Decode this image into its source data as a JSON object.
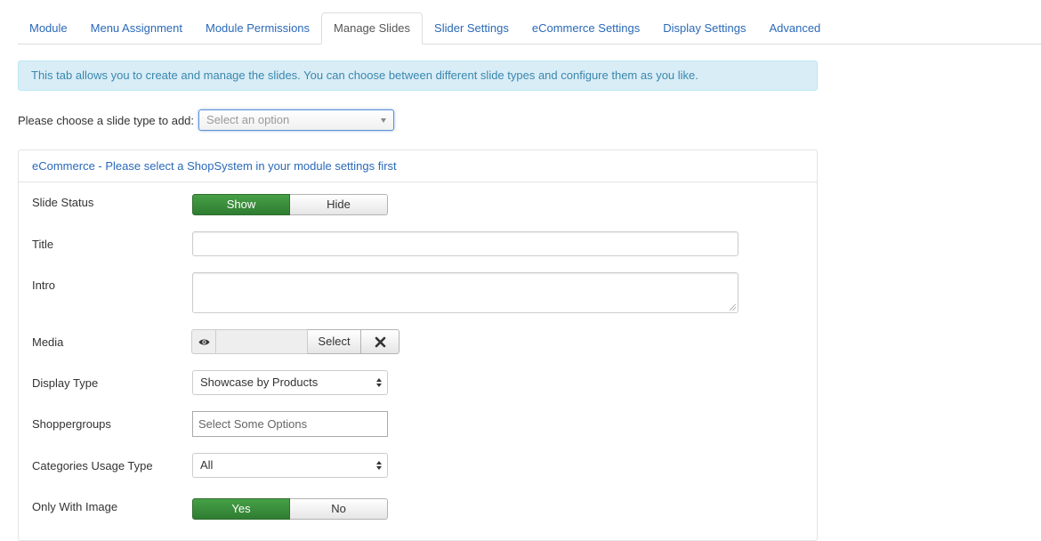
{
  "tabs": [
    {
      "label": "Module",
      "active": false
    },
    {
      "label": "Menu Assignment",
      "active": false
    },
    {
      "label": "Module Permissions",
      "active": false
    },
    {
      "label": "Manage Slides",
      "active": true
    },
    {
      "label": "Slider Settings",
      "active": false
    },
    {
      "label": "eCommerce Settings",
      "active": false
    },
    {
      "label": "Display Settings",
      "active": false
    },
    {
      "label": "Advanced",
      "active": false
    }
  ],
  "info_message": "This tab allows you to create and manage the slides. You can choose between different slide types and configure them as you like.",
  "add_slide": {
    "label": "Please choose a slide type to add:",
    "placeholder": "Select an option"
  },
  "panel": {
    "title": "eCommerce - Please select a ShopSystem in your module settings first",
    "slide_status": {
      "label": "Slide Status",
      "on": "Show",
      "off": "Hide",
      "selected": "Show"
    },
    "title_field": {
      "label": "Title",
      "value": ""
    },
    "intro": {
      "label": "Intro",
      "value": ""
    },
    "media": {
      "label": "Media",
      "select_label": "Select",
      "preview_icon": "eye-icon",
      "clear_icon": "close-icon"
    },
    "display_type": {
      "label": "Display Type",
      "value": "Showcase by Products"
    },
    "shoppergroups": {
      "label": "Shoppergroups",
      "placeholder": "Select Some Options"
    },
    "categories_usage_type": {
      "label": "Categories Usage Type",
      "value": "All"
    },
    "only_with_image": {
      "label": "Only With Image",
      "on": "Yes",
      "off": "No",
      "selected": "Yes"
    }
  },
  "colors": {
    "link": "#2a69b8",
    "success": "#3d8b3d",
    "info_bg": "#d9edf7",
    "info_text": "#3a87ad"
  }
}
